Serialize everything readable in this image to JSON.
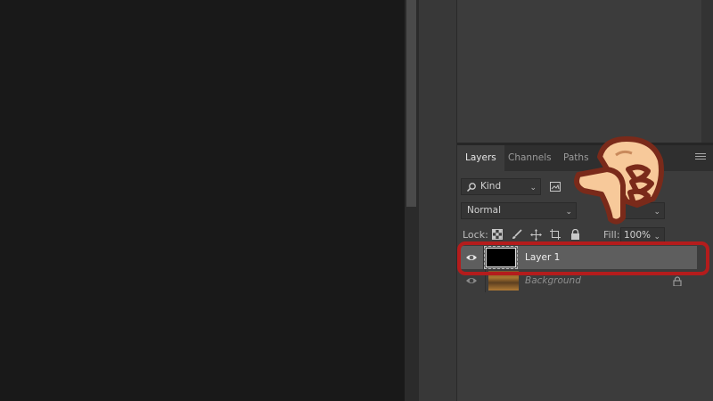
{
  "layers_panel": {
    "tabs": [
      {
        "label": "Layers",
        "active": true
      },
      {
        "label": "Channels",
        "active": false
      },
      {
        "label": "Paths",
        "active": false
      }
    ],
    "filter": {
      "search_icon": "search-icon",
      "kind_label": "Kind"
    },
    "blend_mode": "Normal",
    "lock_label": "Lock:",
    "fill_label": "Fill:",
    "fill_value": "100%",
    "layers": [
      {
        "name": "Layer 1",
        "selected": true,
        "visible": true,
        "thumbnail": "black"
      },
      {
        "name": "Background",
        "selected": false,
        "visible": true,
        "locked": true,
        "thumbnail": "image"
      }
    ]
  },
  "colors": {
    "highlight": "#b41c1c",
    "hand_skin": "#f7c99a",
    "hand_outline": "#7a2a1a"
  }
}
